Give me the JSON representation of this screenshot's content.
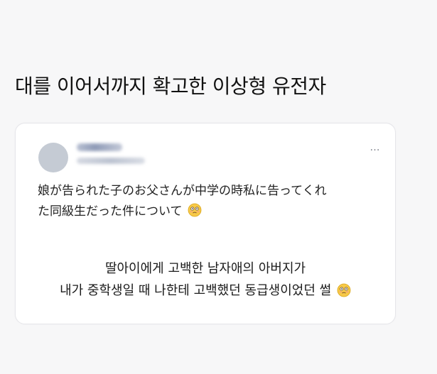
{
  "post": {
    "title": "대를 이어서까지 확고한 이상형 유전자"
  },
  "tweet": {
    "more_icon": "…",
    "japanese_line1": "娘が告られた子のお父さんが中学の時私に告ってくれ",
    "japanese_line2": "た同級生だった件について",
    "korean_line1": "딸아이에게 고백한 남자애의 아버지가",
    "korean_line2": "내가 중학생일 때 나한테 고백했던 동급생이었던 썰"
  },
  "icons": {
    "avatar": "avatar-placeholder",
    "more": "more-options-icon",
    "emoji": "flushed-face-emoji"
  },
  "colors": {
    "background": "#f7f7f8",
    "card": "#ffffff",
    "border": "#e6e6ea",
    "text": "#111111"
  }
}
